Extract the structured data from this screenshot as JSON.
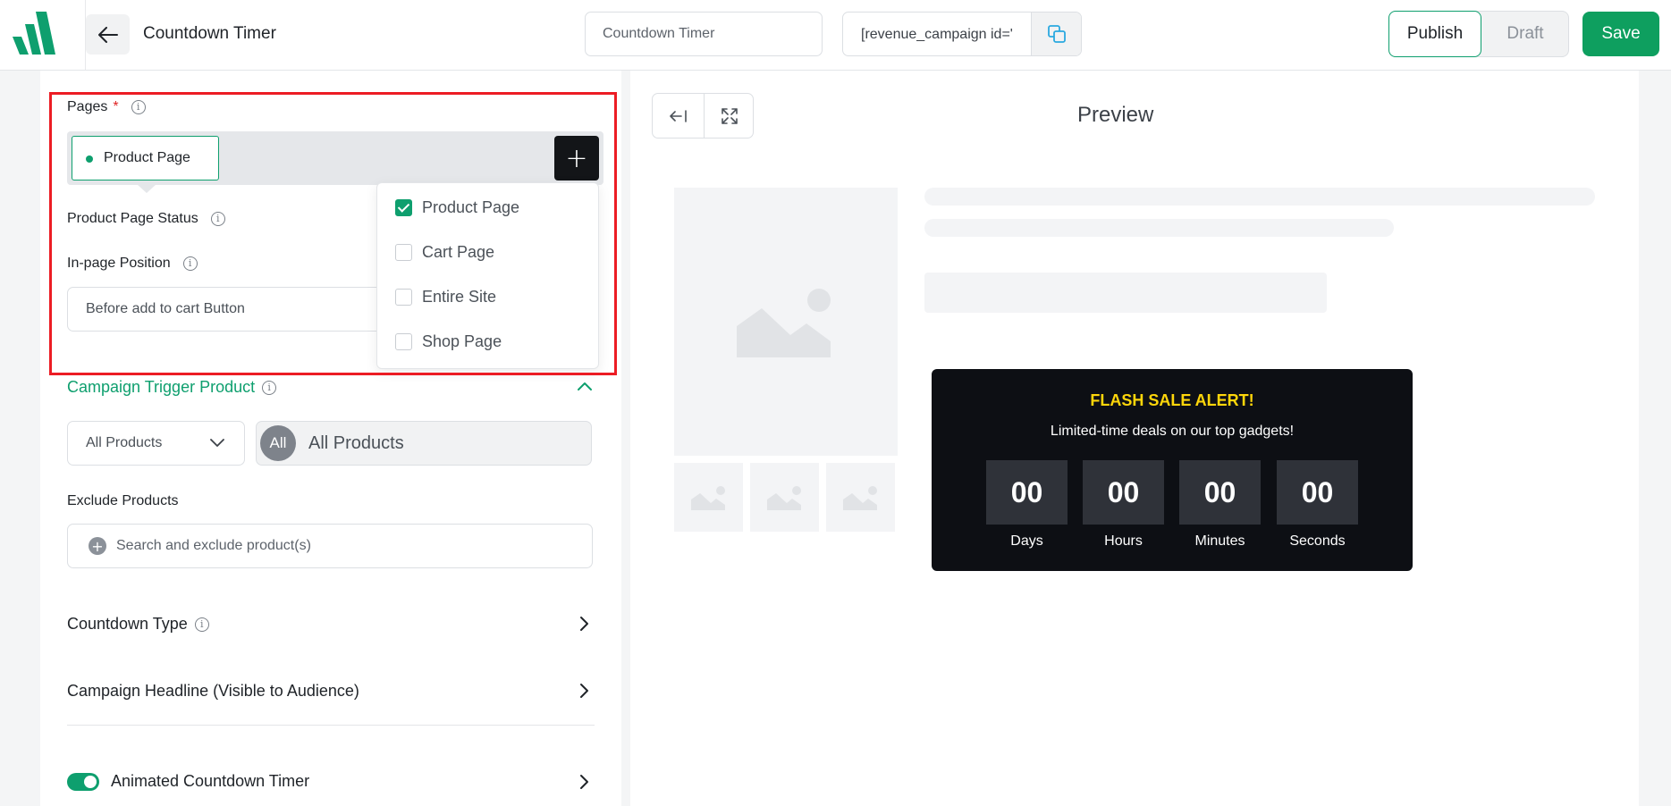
{
  "header": {
    "title": "Countdown Timer",
    "campaign_name_value": "Countdown Timer",
    "shortcode_value": "[revenue_campaign id='",
    "publish_label": "Publish",
    "draft_label": "Draft",
    "save_label": "Save"
  },
  "pages_section": {
    "label": "Pages",
    "required_mark": "*",
    "selected_chip": "Product Page",
    "dropdown_options": [
      {
        "label": "Product Page",
        "checked": true
      },
      {
        "label": "Cart Page",
        "checked": false
      },
      {
        "label": "Entire Site",
        "checked": false
      },
      {
        "label": "Shop Page",
        "checked": false
      }
    ],
    "status_label": "Product Page Status",
    "position_label": "In-page Position",
    "position_value": "Before add to cart Button"
  },
  "trigger_section": {
    "title": "Campaign Trigger Product",
    "select_value": "All Products",
    "badge_text": "All",
    "selected_text": "All Products",
    "exclude_label": "Exclude Products",
    "exclude_placeholder": "Search and exclude product(s)"
  },
  "rows": {
    "countdown_type": "Countdown Type",
    "campaign_headline": "Campaign Headline (Visible to Audience)",
    "animated_timer": "Animated Countdown Timer"
  },
  "preview": {
    "title": "Preview",
    "headline": "FLASH SALE ALERT!",
    "subheadline": "Limited-time deals on our top gadgets!",
    "units": [
      {
        "value": "00",
        "label": "Days"
      },
      {
        "value": "00",
        "label": "Hours"
      },
      {
        "value": "00",
        "label": "Minutes"
      },
      {
        "value": "00",
        "label": "Seconds"
      }
    ]
  },
  "colors": {
    "accent": "#0e9f6e",
    "timer_bg": "#0d0f14",
    "headline": "#ffd60a",
    "highlight": "#ec1c24"
  }
}
